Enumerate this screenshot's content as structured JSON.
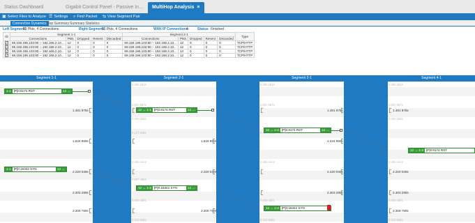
{
  "tabs": [
    {
      "label": "Status Dashboard",
      "active": false
    },
    {
      "label": "Gigabit Control Panel - Passive In...",
      "active": false
    },
    {
      "label": "MultiHop Analysis",
      "active": true
    }
  ],
  "toolbar": {
    "select_files": "Select Files to Analyze",
    "settings": "Settings",
    "find_packet": "Find Packet",
    "view_segment_pair": "View Segment Pair"
  },
  "subtabs": [
    "Connection Dynamics",
    "Hop Summary",
    "Summary Statistics"
  ],
  "seginfo": {
    "left_label": "Left Segment:",
    "left_value": "55 Pkts, 4 Connections",
    "right_label": "Right Segment:",
    "right_value": "55 Pkts, 4 Connections",
    "wan_label": "WAN IP Connections:",
    "wan_value": "4",
    "status_label": "Status:",
    "status_value": "Finished"
  },
  "table": {
    "group_left": "Segment 1-1",
    "group_right": "Segment 2-1",
    "headers": [
      "ID",
      "Connections",
      "Pkts",
      "Dropped",
      "Resent",
      "Discarded",
      "Connections",
      "Pkts",
      "Dropped",
      "Resent",
      "Discarded",
      "Type"
    ],
    "rows": [
      [
        "",
        "69.159.196.103:80 -- 192.168.2.10...",
        "12",
        "0",
        "0",
        "0",
        "69.159.196.103:80 -- 192.168.2.10...",
        "12",
        "0",
        "0",
        "0",
        "TCP/HTTP"
      ],
      [
        "",
        "69.159.196.103:80 -- 192.168.2.10...",
        "12",
        "0",
        "0",
        "0",
        "69.159.196.103:80 -- 192.168.2.10...",
        "12",
        "0",
        "0",
        "0",
        "TCP/HTTP"
      ],
      [
        "",
        "69.159.196.103:80 -- 192.168.2.10...",
        "14",
        "0",
        "0",
        "0",
        "69.159.196.103:80 -- 192.168.2.10...",
        "14",
        "0",
        "0",
        "0",
        "TCP/HTTP"
      ],
      [
        "",
        "69.159.196.103:80 -- 192.168.2.10...",
        "12",
        "0",
        "0",
        "0",
        "69.159.196.103:80 -- 192.168.2.10...",
        "12",
        "0",
        "0",
        "0",
        "TCP/HTTP"
      ]
    ]
  },
  "segments": [
    "Segment 1-1",
    "Segment 2-1",
    "Segment 2-1",
    "Segment 4-1"
  ],
  "ladder": {
    "lane1_times": [
      "1.481 975s",
      "1.634 980s",
      "2.220 030s",
      "2.303 290s",
      "2.308 780s"
    ],
    "lane2_times": [
      "1.481 975s",
      "1.634 980s",
      "2.220 030s",
      "2.303 290s",
      "2.308 780s"
    ],
    "lane3_times": [
      "1.481 975s",
      "1.634 980s",
      "2.220 030s",
      "2.303 290s",
      "2.308 780s"
    ],
    "lane4_times": [
      "1.481 975s",
      "1.634 980s",
      "2.220 030s",
      "2.303 290s",
      "2.308 780s"
    ],
    "faint": [
      "0.000 284s",
      "0.001 587s",
      "0.005 328s",
      "0.127 848s",
      "0.235 041s",
      "0.587 285s",
      "0.803 485s",
      "0.812 848s"
    ],
    "packets": {
      "p1": {
        "left": "1-1",
        "label": "[P]0:8174 RST",
        "right": "12 →"
      },
      "p2": {
        "left": "12 → 1-1",
        "label": "[P]0:8174 RST",
        "right": "12 →"
      },
      "p3": {
        "left": "12 → 1-2",
        "label": "[P]0:8174 RST",
        "right": "12 →"
      },
      "p4": {
        "left": "12 → 1-2",
        "label": "[P]0:8174 RST",
        "right": ""
      },
      "p5": {
        "left": "1-1",
        "label": "[P]0:16342 SYN",
        "right": "12 →"
      },
      "p6": {
        "left": "12 → 1-2",
        "label": "[P]0:16342 SYN",
        "right": "12 →"
      },
      "p7": {
        "left": "12 → 1-2",
        "label": "[P]0:16342 SYN",
        "right": ""
      }
    }
  }
}
